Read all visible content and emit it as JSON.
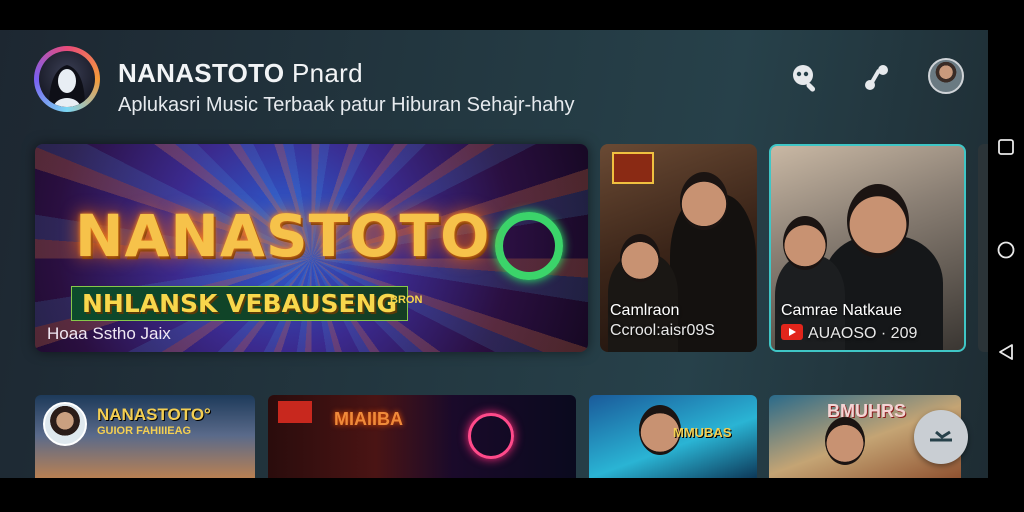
{
  "header": {
    "app_name": "NANASTOTO",
    "app_name_suffix": " Pnard",
    "subtitle": "Aplukasri Music Terbaak patur Hiburan Sehajr-hahy",
    "icons": [
      "search-icon",
      "music-note-icon",
      "avatar"
    ]
  },
  "featured": {
    "title": "NANASTOTO",
    "subtitle": "NHLANSK VEBAUSENG",
    "badge": "BRON",
    "caption": "Hoaa Sstho Jaix"
  },
  "cards": [
    {
      "badge": "",
      "name": "Camlraon",
      "meta": "Ccrool:aisr09S"
    },
    {
      "name": "Camrae Natkaue",
      "meta": "AUAOSO · 209"
    }
  ],
  "row2": [
    {
      "title": "NANASTOTO°",
      "sub": "GUIOR FAHIIIEAG"
    },
    {
      "title": "MIAIIBA"
    },
    {
      "title": "MMUBAS"
    },
    {
      "title": "BMUHRS"
    }
  ],
  "fab": {
    "icon": "shuffle-icon"
  },
  "colors": {
    "accent": "#f6c24a",
    "card_border": "#3fc6c6",
    "background": "#233841"
  }
}
